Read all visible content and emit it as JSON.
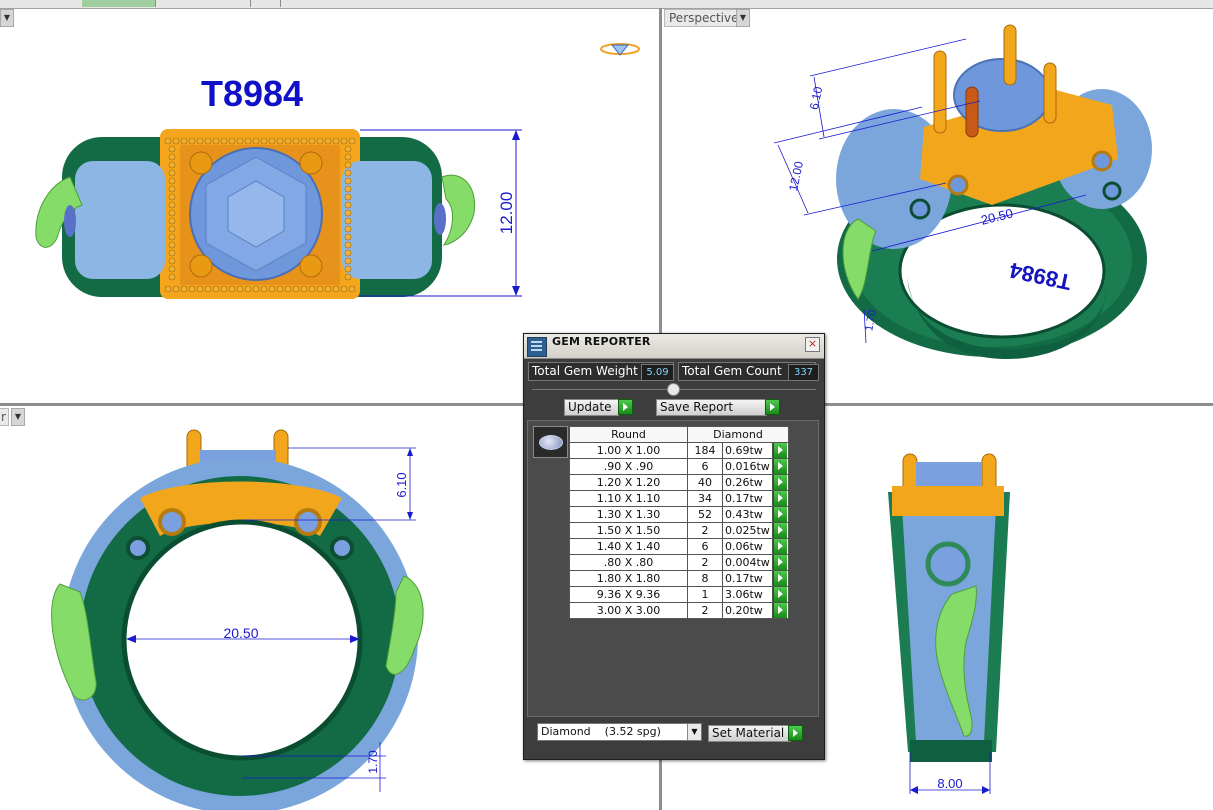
{
  "viewports": {
    "top_left": {
      "model_label": "T8984"
    },
    "top_right": {
      "label": "Perspective",
      "model_label": "T8984",
      "dim_height": "12.00",
      "dim_top": "6.10",
      "dim_inner": "20.50",
      "dim_band": "1.70"
    },
    "top_left_dims": {
      "height": "12.00"
    },
    "bottom_left": {
      "label": "r",
      "dim_top": "6.10",
      "dim_inner": "20.50",
      "dim_band": "1.70"
    },
    "bottom_right": {
      "dim_width": "8.00"
    }
  },
  "gem_reporter": {
    "title": "GEM REPORTER",
    "total_weight_label": "Total Gem Weight",
    "total_weight": "5.09",
    "total_count_label": "Total Gem Count",
    "total_count": "337",
    "update_label": "Update",
    "save_report_label": "Save Report",
    "table": {
      "shape_header": "Round",
      "material_header": "Diamond",
      "rows": [
        {
          "size": "1.00 X 1.00",
          "count": "184",
          "weight": "0.69tw"
        },
        {
          "size": ".90 X .90",
          "count": "6",
          "weight": "0.016tw"
        },
        {
          "size": "1.20 X 1.20",
          "count": "40",
          "weight": "0.26tw"
        },
        {
          "size": "1.10 X 1.10",
          "count": "34",
          "weight": "0.17tw"
        },
        {
          "size": "1.30 X 1.30",
          "count": "52",
          "weight": "0.43tw"
        },
        {
          "size": "1.50 X 1.50",
          "count": "2",
          "weight": "0.025tw"
        },
        {
          "size": "1.40 X 1.40",
          "count": "6",
          "weight": "0.06tw"
        },
        {
          "size": ".80 X .80",
          "count": "2",
          "weight": "0.004tw"
        },
        {
          "size": "1.80 X 1.80",
          "count": "8",
          "weight": "0.17tw"
        },
        {
          "size": "9.36 X 9.36",
          "count": "1",
          "weight": "3.06tw"
        },
        {
          "size": "3.00 X 3.00",
          "count": "2",
          "weight": "0.20tw"
        }
      ]
    },
    "material_select": "Diamond    (3.52 spg)",
    "set_material_label": "Set Material"
  },
  "colors": {
    "band": "#0f6e4a",
    "gold": "#f2a81c",
    "gem": "#7aa0e0",
    "figure": "#8ee06a",
    "dims": "#1a1ad0"
  }
}
